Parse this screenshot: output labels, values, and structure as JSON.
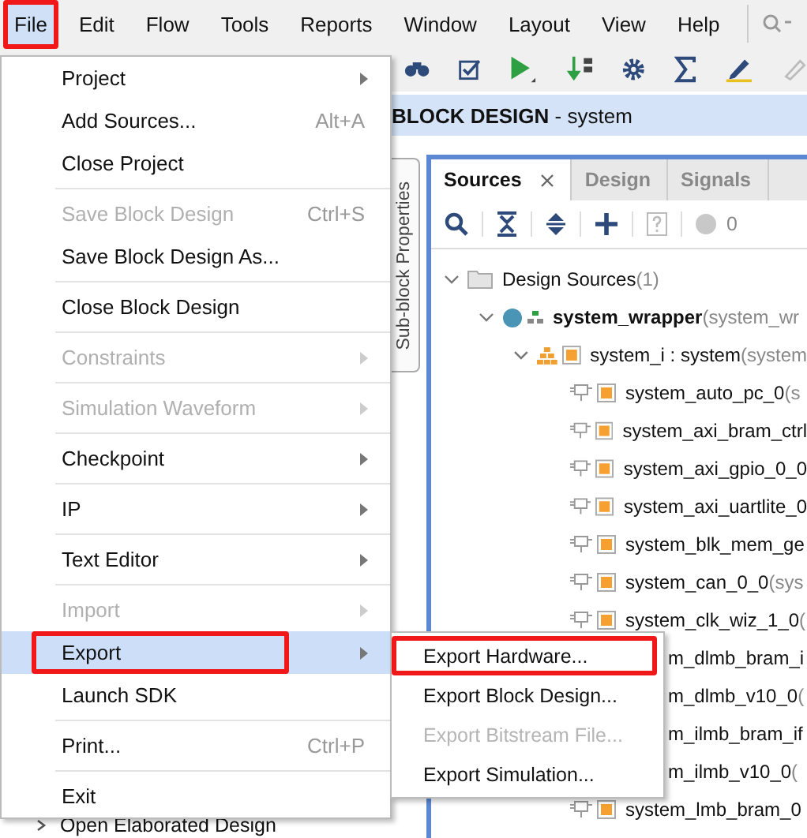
{
  "menu_bar": {
    "items": [
      {
        "label": "File",
        "selected": true,
        "annotated": true
      },
      {
        "label": "Edit",
        "selected": false,
        "annotated": false
      },
      {
        "label": "Flow",
        "selected": false,
        "annotated": false
      },
      {
        "label": "Tools",
        "selected": false,
        "annotated": false
      },
      {
        "label": "Reports",
        "selected": false,
        "annotated": false
      },
      {
        "label": "Window",
        "selected": false,
        "annotated": false
      },
      {
        "label": "Layout",
        "selected": false,
        "annotated": false
      },
      {
        "label": "View",
        "selected": false,
        "annotated": false
      },
      {
        "label": "Help",
        "selected": false,
        "annotated": false
      }
    ]
  },
  "header": {
    "title": "**BLOCK DESIGN** - system"
  },
  "side_tab": {
    "label": "Sub-block Properties"
  },
  "sources_panel": {
    "tabs": [
      {
        "label": "Sources",
        "selected": true
      },
      {
        "label": "Design",
        "selected": false
      },
      {
        "label": "Signals",
        "selected": false
      }
    ],
    "issue_count": "0",
    "tree": [
      {
        "kind": "folder",
        "label": "Design Sources",
        "detail": "(1)",
        "expanded": true,
        "children": [
          {
            "kind": "wrapper",
            "label": "system_wrapper",
            "detail": "(system_wr",
            "expanded": true,
            "children": [
              {
                "kind": "hierarchy",
                "label": "system_i : system",
                "detail": "(system",
                "expanded": true,
                "children": [
                  {
                    "kind": "ip",
                    "label": "system_auto_pc_0",
                    "detail": "(s"
                  },
                  {
                    "kind": "ip",
                    "label": "system_axi_bram_ctrl"
                  },
                  {
                    "kind": "ip",
                    "label": "system_axi_gpio_0_0"
                  },
                  {
                    "kind": "ip",
                    "label": "system_axi_uartlite_0"
                  },
                  {
                    "kind": "ip",
                    "label": "system_blk_mem_ge"
                  },
                  {
                    "kind": "ip",
                    "label": "system_can_0_0",
                    "detail": "(sys"
                  },
                  {
                    "kind": "ip",
                    "label": "system_clk_wiz_1_0",
                    "detail": "("
                  },
                  {
                    "kind": "clipped",
                    "label": "m_dlmb_bram_i"
                  },
                  {
                    "kind": "clipped",
                    "label": "m_dlmb_v10_0",
                    "detail": "("
                  },
                  {
                    "kind": "clipped",
                    "label": "m_ilmb_bram_if"
                  },
                  {
                    "kind": "clipped",
                    "label": "m_ilmb_v10_0",
                    "detail": "("
                  },
                  {
                    "kind": "ip",
                    "label": "system_lmb_bram_0"
                  }
                ]
              }
            ]
          }
        ]
      }
    ]
  },
  "flow_navigator": {
    "items": [
      {
        "label": "Open Elaborated Design"
      }
    ]
  },
  "file_menu": {
    "items": [
      {
        "kind": "item",
        "label": "Project",
        "submenu": true,
        "disabled": false,
        "selected": false,
        "annotated": false
      },
      {
        "kind": "item",
        "label": "Add Sources...",
        "shortcut": "Alt+A",
        "submenu": false,
        "disabled": false,
        "selected": false,
        "annotated": false
      },
      {
        "kind": "item",
        "label": "Close Project",
        "submenu": false,
        "disabled": false,
        "selected": false,
        "annotated": false
      },
      {
        "kind": "separator"
      },
      {
        "kind": "item",
        "label": "Save Block Design",
        "shortcut": "Ctrl+S",
        "submenu": false,
        "disabled": true,
        "selected": false,
        "annotated": false
      },
      {
        "kind": "item",
        "label": "Save Block Design As...",
        "submenu": false,
        "disabled": false,
        "selected": false,
        "annotated": false
      },
      {
        "kind": "separator"
      },
      {
        "kind": "item",
        "label": "Close Block Design",
        "submenu": false,
        "disabled": false,
        "selected": false,
        "annotated": false
      },
      {
        "kind": "separator"
      },
      {
        "kind": "item",
        "label": "Constraints",
        "submenu": true,
        "disabled": true,
        "selected": false,
        "annotated": false
      },
      {
        "kind": "separator"
      },
      {
        "kind": "item",
        "label": "Simulation Waveform",
        "submenu": true,
        "disabled": true,
        "selected": false,
        "annotated": false
      },
      {
        "kind": "separator"
      },
      {
        "kind": "item",
        "label": "Checkpoint",
        "submenu": true,
        "disabled": false,
        "selected": false,
        "annotated": false
      },
      {
        "kind": "separator"
      },
      {
        "kind": "item",
        "label": "IP",
        "submenu": true,
        "disabled": false,
        "selected": false,
        "annotated": false
      },
      {
        "kind": "separator"
      },
      {
        "kind": "item",
        "label": "Text Editor",
        "submenu": true,
        "disabled": false,
        "selected": false,
        "annotated": false
      },
      {
        "kind": "separator"
      },
      {
        "kind": "item",
        "label": "Import",
        "submenu": true,
        "disabled": true,
        "selected": false,
        "annotated": false
      },
      {
        "kind": "item",
        "label": "Export",
        "submenu": true,
        "disabled": false,
        "selected": true,
        "annotated": true
      },
      {
        "kind": "item",
        "label": "Launch SDK",
        "submenu": false,
        "disabled": false,
        "selected": false,
        "annotated": false
      },
      {
        "kind": "separator"
      },
      {
        "kind": "item",
        "label": "Print...",
        "shortcut": "Ctrl+P",
        "submenu": false,
        "disabled": false,
        "selected": false,
        "annotated": false
      },
      {
        "kind": "separator"
      },
      {
        "kind": "item",
        "label": "Exit",
        "submenu": false,
        "disabled": false,
        "selected": false,
        "annotated": false
      }
    ]
  },
  "export_submenu": {
    "items": [
      {
        "label": "Export Hardware...",
        "disabled": false,
        "annotated": true
      },
      {
        "label": "Export Block Design...",
        "disabled": false,
        "annotated": false
      },
      {
        "label": "Export Bitstream File...",
        "disabled": true,
        "annotated": false
      },
      {
        "label": "Export Simulation...",
        "disabled": false,
        "annotated": false
      }
    ]
  }
}
